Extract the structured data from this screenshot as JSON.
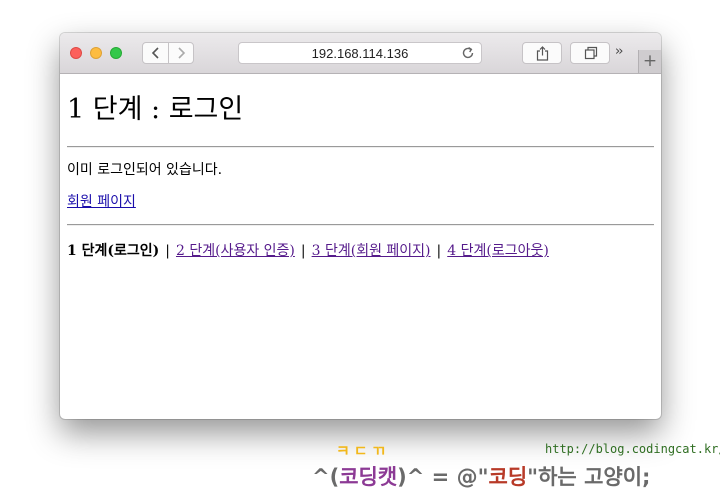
{
  "browser": {
    "address": "192.168.114.136",
    "more_label": "››",
    "new_tab_label": "+",
    "icons": [
      "back-icon",
      "forward-icon",
      "reload-icon",
      "share-icon",
      "tabs-icon"
    ],
    "colors": {
      "close": "#fc605c",
      "minimize": "#fdbc40",
      "zoom": "#34c84a"
    }
  },
  "page": {
    "heading": "1 단계 : 로그인",
    "message": "이미 로그인되어 있습니다.",
    "member_link": "회원 페이지",
    "steps": [
      {
        "label": "1 단계(로그인)",
        "current": true
      },
      {
        "label": "2 단계(사용자 인증)",
        "current": false
      },
      {
        "label": "3 단계(회원 페이지)",
        "current": false
      },
      {
        "label": "4 단계(로그아웃)",
        "current": false
      }
    ],
    "separator": "|"
  },
  "watermark": {
    "line1": "ㅋㄷㄲ",
    "url": "http://blog.codingcat.kr/",
    "part1": "^(",
    "name": "코딩캣",
    "part2": ")^ = @\"",
    "coding": "코딩",
    "part3": "\"하는 고양이;"
  }
}
